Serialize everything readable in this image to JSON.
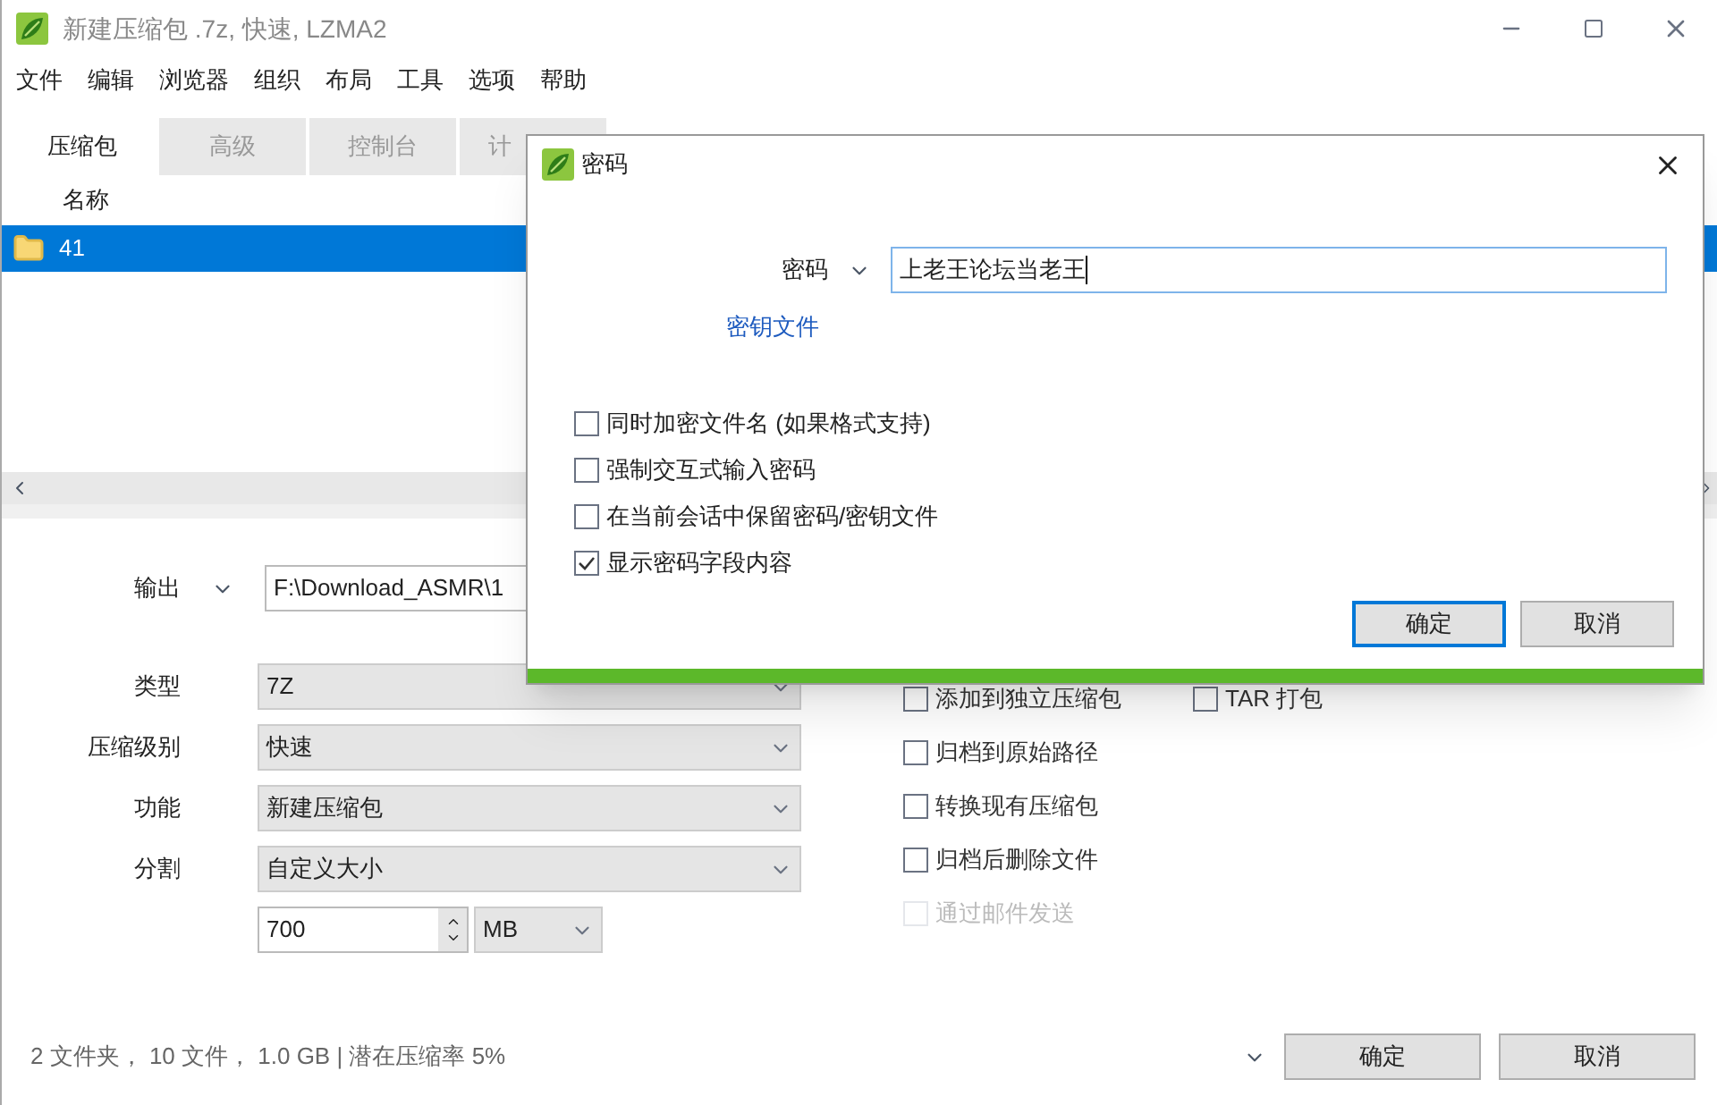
{
  "window": {
    "title": "新建压缩包 .7z, 快速, LZMA2"
  },
  "menu": [
    "文件",
    "编辑",
    "浏览器",
    "组织",
    "布局",
    "工具",
    "选项",
    "帮助"
  ],
  "tabs": [
    {
      "label": "压缩包",
      "selected": true
    },
    {
      "label": "高级",
      "selected": false
    },
    {
      "label": "控制台",
      "selected": false
    },
    {
      "label": "计",
      "selected": false
    }
  ],
  "file_list": {
    "columns": [
      "名称"
    ],
    "rows": [
      {
        "name": "41",
        "selected": true
      }
    ]
  },
  "output": {
    "label": "输出",
    "value": "F:\\Download_ASMR\\1"
  },
  "options": [
    {
      "label": "类型",
      "value": "7Z"
    },
    {
      "label": "压缩级别",
      "value": "快速"
    },
    {
      "label": "功能",
      "value": "新建压缩包"
    },
    {
      "label": "分割",
      "value": "自定义大小"
    }
  ],
  "split_size": {
    "value": "700",
    "unit": "MB"
  },
  "checkbox_rows": [
    [
      {
        "label": "添加到独立压缩包",
        "checked": false,
        "disabled": false
      },
      {
        "label": "TAR 打包",
        "checked": false,
        "disabled": false
      }
    ],
    [
      {
        "label": "归档到原始路径",
        "checked": false,
        "disabled": false
      }
    ],
    [
      {
        "label": "转换现有压缩包",
        "checked": false,
        "disabled": false
      }
    ],
    [
      {
        "label": "归档后删除文件",
        "checked": false,
        "disabled": false
      }
    ],
    [
      {
        "label": "通过邮件发送",
        "checked": false,
        "disabled": true
      }
    ]
  ],
  "status": "2 文件夹， 10 文件， 1.0 GB | 潜在压缩率 5%",
  "buttons": [
    "确定",
    "取消"
  ],
  "dialog": {
    "title": "密码",
    "password_label": "密码",
    "password": "上老王论坛当老王",
    "key_file_link": "密钥文件",
    "options": [
      {
        "label": "同时加密文件名 (如果格式支持)",
        "checked": false
      },
      {
        "label": "强制交互式输入密码",
        "checked": false
      },
      {
        "label": "在当前会话中保留密码/密钥文件",
        "checked": false
      },
      {
        "label": "显示密码字段内容",
        "checked": true
      }
    ],
    "buttons": [
      "确定",
      "取消"
    ]
  }
}
